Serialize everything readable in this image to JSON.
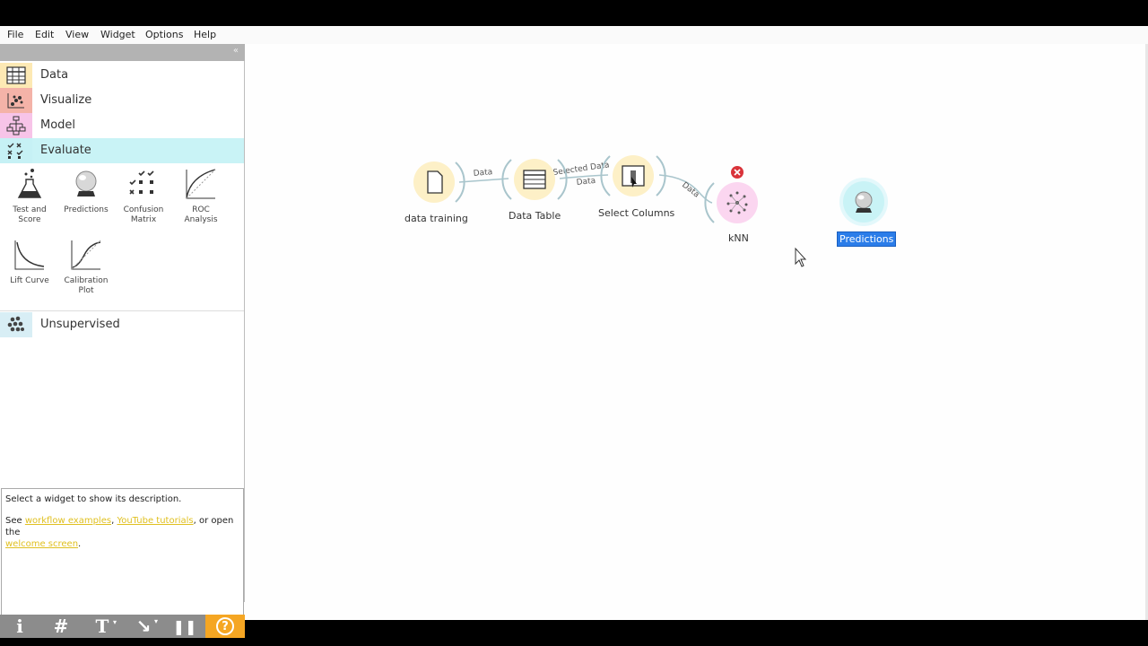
{
  "menu": [
    "File",
    "Edit",
    "View",
    "Widget",
    "Options",
    "Help"
  ],
  "categories": {
    "data": "Data",
    "visualize": "Visualize",
    "model": "Model",
    "evaluate": "Evaluate",
    "unsupervised": "Unsupervised"
  },
  "tools": {
    "test_score": [
      "Test and",
      "Score"
    ],
    "predictions": "Predictions",
    "confusion": [
      "Confusion",
      "Matrix"
    ],
    "roc": [
      "ROC",
      "Analysis"
    ],
    "lift": "Lift Curve",
    "calibration": [
      "Calibration",
      "Plot"
    ]
  },
  "description": {
    "line1": "Select a widget to show its description.",
    "see": "See ",
    "link1": "workflow examples",
    "comma": ", ",
    "link2": "YouTube tutorials",
    "or_open": ", or open the",
    "link3": "welcome screen",
    "period": "."
  },
  "toolbar": {
    "info": "i",
    "grid": "#",
    "text": "T",
    "arrow": "↘",
    "pause": "❚❚",
    "help": "?"
  },
  "workflow": {
    "nodes": {
      "data_training": "data training",
      "data_table": "Data Table",
      "select_columns": "Select Columns",
      "knn": "kNN",
      "predictions": "Predictions"
    },
    "links": {
      "l1": "Data",
      "l2a": "Selected Data",
      "l2b": "Data",
      "l3": "Data"
    }
  },
  "colors": {
    "data_cat": "#fde9b4",
    "visualize_cat": "#f4b3a8",
    "model_cat": "#f7c4e8",
    "evaluate_cat": "#c6f1f5",
    "evaluate_row": "#c9f3f6",
    "unsupervised_cat": "#d8eef5",
    "help_button": "#f5a623",
    "error": "#d9333a",
    "selected_label": "#2b7de9"
  }
}
